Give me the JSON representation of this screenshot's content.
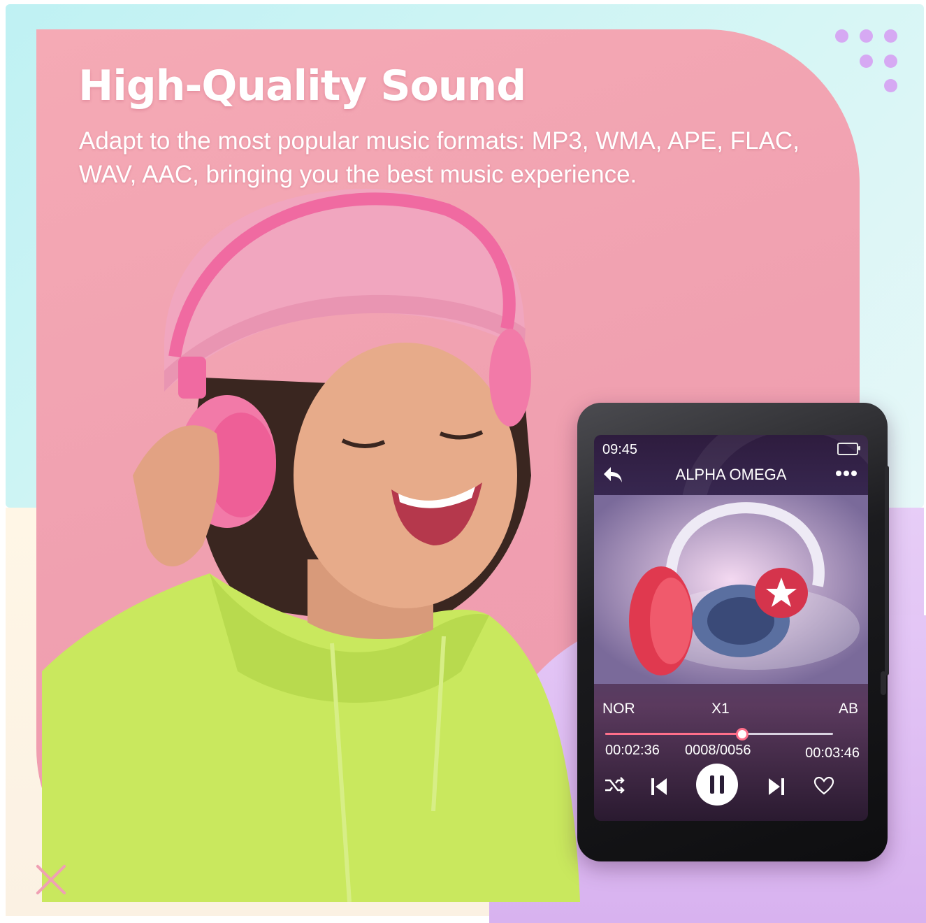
{
  "banner": {
    "headline": "High-Quality Sound",
    "subhead": "Adapt to the most popular music formats: MP3, WMA, APE, FLAC, WAV, AAC, bringing you the best music experience."
  },
  "player": {
    "clock": "09:45",
    "song_title": "ALPHA OMEGA",
    "mode_left": "NOR",
    "mode_center": "X1",
    "mode_right": "AB",
    "elapsed": "00:02:36",
    "track_counter": "0008/0056",
    "total": "00:03:46",
    "progress": 0.6
  },
  "colors": {
    "panel_pink": "#f2a3b3",
    "accent_red": "#ff6f8a",
    "lavender": "#d9b5f0",
    "cyan": "#bff1f3"
  },
  "icons": [
    "battery-icon",
    "back-arrow-icon",
    "more-options-icon",
    "shuffle-icon",
    "previous-track-icon",
    "pause-icon",
    "next-track-icon",
    "heart-icon",
    "close-x-icon",
    "dots-decoration"
  ]
}
